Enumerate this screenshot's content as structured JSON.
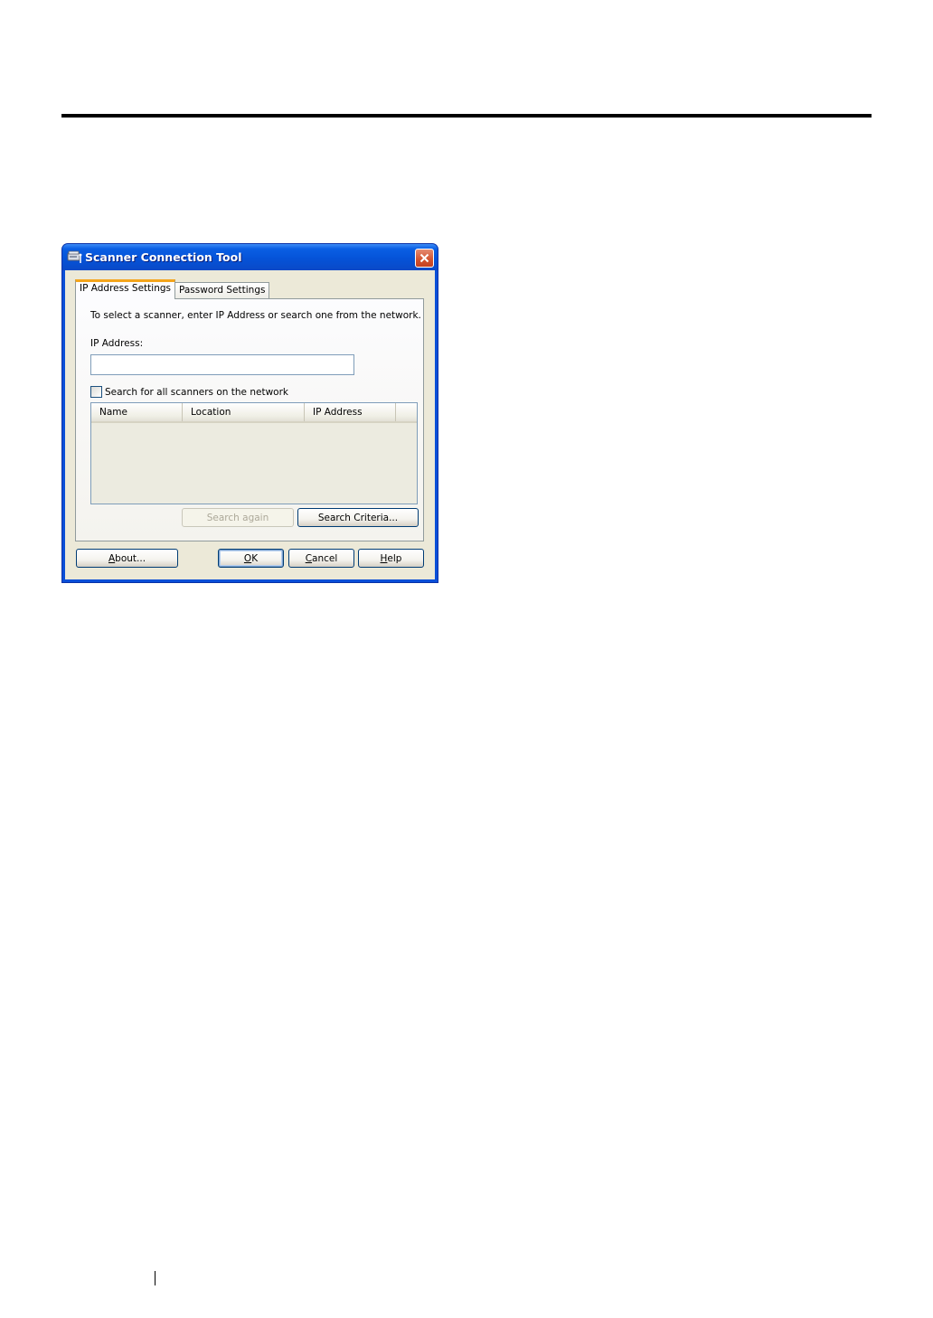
{
  "dialog": {
    "title": "Scanner Connection Tool",
    "icon": "scanner-app-icon",
    "close_icon": "close-icon",
    "colors": {
      "titlebar": "#0553d8",
      "client": "#ece9d8",
      "close": "#d3532f",
      "active_tab_accent": "#f4a51b"
    }
  },
  "tabs": [
    {
      "label": "IP Address Settings",
      "active": true
    },
    {
      "label": "Password Settings",
      "active": false
    }
  ],
  "panel": {
    "instruction": "To select a scanner, enter IP Address or search one from the network.",
    "ip_label": "IP Address:",
    "ip_value": "",
    "search_all_label": "Search for all scanners on the network",
    "search_all_checked": false,
    "columns": [
      "Name",
      "Location",
      "IP Address"
    ],
    "rows": [],
    "search_again_label": "Search again",
    "search_criteria_label": "Search Criteria..."
  },
  "buttons": {
    "about": {
      "label": "About...",
      "mnemonic": "A",
      "rest": "bout..."
    },
    "ok": {
      "label": "OK",
      "mnemonic": "O",
      "rest": "K"
    },
    "cancel": {
      "label": "Cancel",
      "mnemonic": "C",
      "rest": "ancel"
    },
    "help": {
      "label": "Help",
      "mnemonic": "H",
      "rest": "elp"
    }
  }
}
